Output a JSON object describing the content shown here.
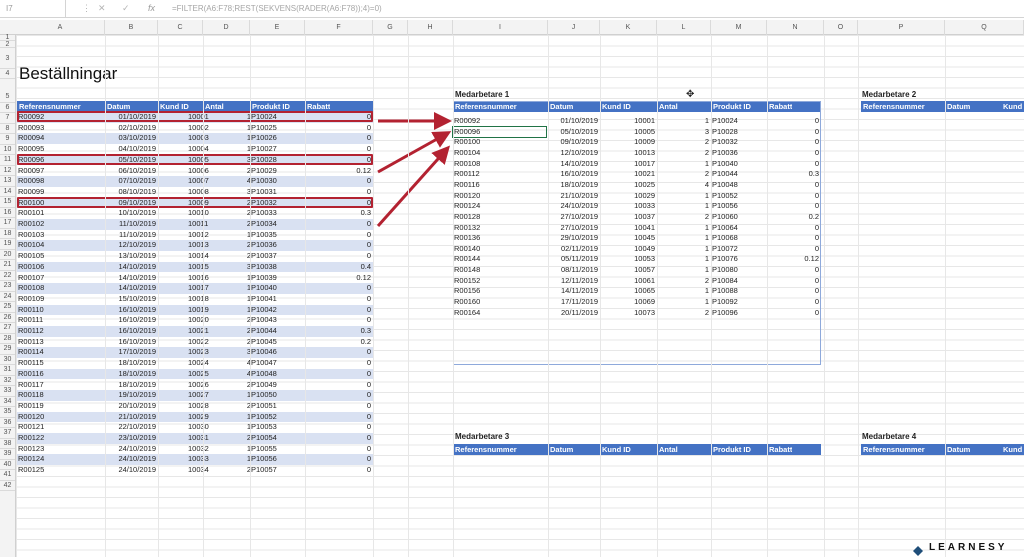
{
  "formula_bar": {
    "name_box": "I7",
    "cancel_icon": "✕",
    "enter_icon": "✓",
    "fx_label": "fx",
    "formula": "=FILTER(A6:F78;REST(SEKVENS(RADER(A6:F78));4)=0)"
  },
  "columns": [
    "A",
    "B",
    "C",
    "D",
    "E",
    "F",
    "G",
    "H",
    "I",
    "J",
    "K",
    "L",
    "M",
    "N",
    "O",
    "P",
    "Q"
  ],
  "rows": [
    "1",
    "2",
    "3",
    "4",
    "5",
    "6",
    "7",
    "8",
    "9",
    "10",
    "11",
    "12",
    "13",
    "14",
    "15",
    "16",
    "17",
    "18",
    "19",
    "20",
    "21",
    "22",
    "23",
    "24",
    "25",
    "26",
    "27",
    "28",
    "29",
    "30",
    "31",
    "32",
    "33",
    "34",
    "35",
    "36",
    "37",
    "38",
    "39",
    "40",
    "41",
    "42"
  ],
  "sheet_title": "Beställningar",
  "headers": [
    "Referensnummer",
    "Datum",
    "Kund ID",
    "Antal",
    "Produkt ID",
    "Rabatt"
  ],
  "main_table": [
    [
      "R00092",
      "01/10/2019",
      "10001",
      "1",
      "P10024",
      "0"
    ],
    [
      "R00093",
      "02/10/2019",
      "10002",
      "1",
      "P10025",
      "0"
    ],
    [
      "R00094",
      "03/10/2019",
      "10003",
      "1",
      "P10026",
      "0"
    ],
    [
      "R00095",
      "04/10/2019",
      "10004",
      "1",
      "P10027",
      "0"
    ],
    [
      "R00096",
      "05/10/2019",
      "10005",
      "3",
      "P10028",
      "0"
    ],
    [
      "R00097",
      "06/10/2019",
      "10006",
      "2",
      "P10029",
      "0.12"
    ],
    [
      "R00098",
      "07/10/2019",
      "10007",
      "4",
      "P10030",
      "0"
    ],
    [
      "R00099",
      "08/10/2019",
      "10008",
      "3",
      "P10031",
      "0"
    ],
    [
      "R00100",
      "09/10/2019",
      "10009",
      "2",
      "P10032",
      "0"
    ],
    [
      "R00101",
      "10/10/2019",
      "10010",
      "2",
      "P10033",
      "0.3"
    ],
    [
      "R00102",
      "11/10/2019",
      "10011",
      "2",
      "P10034",
      "0"
    ],
    [
      "R00103",
      "11/10/2019",
      "10012",
      "1",
      "P10035",
      "0"
    ],
    [
      "R00104",
      "12/10/2019",
      "10013",
      "2",
      "P10036",
      "0"
    ],
    [
      "R00105",
      "13/10/2019",
      "10014",
      "2",
      "P10037",
      "0"
    ],
    [
      "R00106",
      "14/10/2019",
      "10015",
      "3",
      "P10038",
      "0.4"
    ],
    [
      "R00107",
      "14/10/2019",
      "10016",
      "1",
      "P10039",
      "0.12"
    ],
    [
      "R00108",
      "14/10/2019",
      "10017",
      "1",
      "P10040",
      "0"
    ],
    [
      "R00109",
      "15/10/2019",
      "10018",
      "1",
      "P10041",
      "0"
    ],
    [
      "R00110",
      "16/10/2019",
      "10019",
      "1",
      "P10042",
      "0"
    ],
    [
      "R00111",
      "16/10/2019",
      "10020",
      "2",
      "P10043",
      "0"
    ],
    [
      "R00112",
      "16/10/2019",
      "10021",
      "2",
      "P10044",
      "0.3"
    ],
    [
      "R00113",
      "16/10/2019",
      "10022",
      "2",
      "P10045",
      "0.2"
    ],
    [
      "R00114",
      "17/10/2019",
      "10023",
      "3",
      "P10046",
      "0"
    ],
    [
      "R00115",
      "18/10/2019",
      "10024",
      "4",
      "P10047",
      "0"
    ],
    [
      "R00116",
      "18/10/2019",
      "10025",
      "4",
      "P10048",
      "0"
    ],
    [
      "R00117",
      "18/10/2019",
      "10026",
      "2",
      "P10049",
      "0"
    ],
    [
      "R00118",
      "19/10/2019",
      "10027",
      "1",
      "P10050",
      "0"
    ],
    [
      "R00119",
      "20/10/2019",
      "10028",
      "2",
      "P10051",
      "0"
    ],
    [
      "R00120",
      "21/10/2019",
      "10029",
      "1",
      "P10052",
      "0"
    ],
    [
      "R00121",
      "22/10/2019",
      "10030",
      "1",
      "P10053",
      "0"
    ],
    [
      "R00122",
      "23/10/2019",
      "10031",
      "2",
      "P10054",
      "0"
    ],
    [
      "R00123",
      "24/10/2019",
      "10032",
      "1",
      "P10055",
      "0"
    ],
    [
      "R00124",
      "24/10/2019",
      "10033",
      "1",
      "P10056",
      "0"
    ],
    [
      "R00125",
      "24/10/2019",
      "10034",
      "2",
      "P10057",
      "0"
    ]
  ],
  "medarbetare1": {
    "title": "Medarbetare 1",
    "rows": [
      [
        "R00092",
        "01/10/2019",
        "10001",
        "1",
        "P10024",
        "0"
      ],
      [
        "R00096",
        "05/10/2019",
        "10005",
        "3",
        "P10028",
        "0"
      ],
      [
        "R00100",
        "09/10/2019",
        "10009",
        "2",
        "P10032",
        "0"
      ],
      [
        "R00104",
        "12/10/2019",
        "10013",
        "2",
        "P10036",
        "0"
      ],
      [
        "R00108",
        "14/10/2019",
        "10017",
        "1",
        "P10040",
        "0"
      ],
      [
        "R00112",
        "16/10/2019",
        "10021",
        "2",
        "P10044",
        "0.3"
      ],
      [
        "R00116",
        "18/10/2019",
        "10025",
        "4",
        "P10048",
        "0"
      ],
      [
        "R00120",
        "21/10/2019",
        "10029",
        "1",
        "P10052",
        "0"
      ],
      [
        "R00124",
        "24/10/2019",
        "10033",
        "1",
        "P10056",
        "0"
      ],
      [
        "R00128",
        "27/10/2019",
        "10037",
        "2",
        "P10060",
        "0.2"
      ],
      [
        "R00132",
        "27/10/2019",
        "10041",
        "1",
        "P10064",
        "0"
      ],
      [
        "R00136",
        "29/10/2019",
        "10045",
        "1",
        "P10068",
        "0"
      ],
      [
        "R00140",
        "02/11/2019",
        "10049",
        "1",
        "P10072",
        "0"
      ],
      [
        "R00144",
        "05/11/2019",
        "10053",
        "1",
        "P10076",
        "0.12"
      ],
      [
        "R00148",
        "08/11/2019",
        "10057",
        "1",
        "P10080",
        "0"
      ],
      [
        "R00152",
        "12/11/2019",
        "10061",
        "2",
        "P10084",
        "0"
      ],
      [
        "R00156",
        "14/11/2019",
        "10065",
        "1",
        "P10088",
        "0"
      ],
      [
        "R00160",
        "17/11/2019",
        "10069",
        "1",
        "P10092",
        "0"
      ],
      [
        "R00164",
        "20/11/2019",
        "10073",
        "2",
        "P10096",
        "0"
      ]
    ]
  },
  "medarbetare2": {
    "title": "Medarbetare 2",
    "headers": [
      "Referensnummer",
      "Datum",
      "Kund"
    ]
  },
  "medarbetare3": {
    "title": "Medarbetare 3"
  },
  "medarbetare4": {
    "title": "Medarbetare 4",
    "headers": [
      "Referensnummer",
      "Datum",
      "Kund ID"
    ]
  },
  "logo_text": "LEARNESY",
  "colors": {
    "header_blue": "#4472c4",
    "band_blue": "#d9e1f2",
    "arrow_red": "#b32231",
    "select_green": "#217346"
  },
  "icons": {
    "cursor": "move-cursor-icon"
  }
}
